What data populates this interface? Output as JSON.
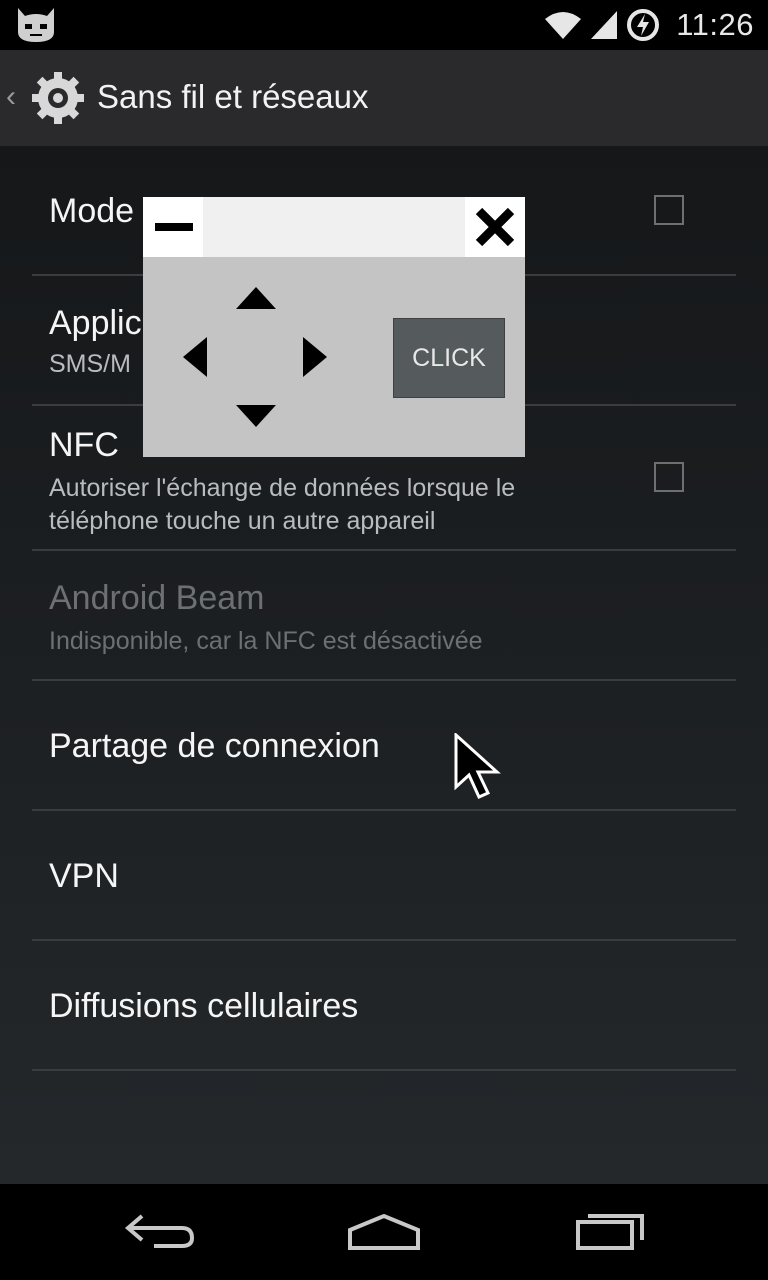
{
  "status_bar": {
    "time": "11:26",
    "icons": [
      "cyanogenmod-logo-icon",
      "wifi-icon",
      "signal-icon",
      "battery-charging-icon"
    ]
  },
  "action_bar": {
    "title": "Sans fil et réseaux",
    "icons": [
      "chevron-left-icon",
      "settings-gear-icon"
    ]
  },
  "settings": {
    "items": [
      {
        "title": "Mode ",
        "summary": "",
        "has_checkbox": true,
        "checked": false,
        "enabled": true
      },
      {
        "title": "Applic",
        "summary": "SMS/M",
        "has_checkbox": false,
        "enabled": true
      },
      {
        "title": "NFC",
        "summary": "Autoriser l'échange de données lorsque le téléphone touche un autre appareil",
        "has_checkbox": true,
        "checked": false,
        "enabled": true
      },
      {
        "title": "Android Beam",
        "summary": "Indisponible, car la NFC est désactivée",
        "has_checkbox": false,
        "enabled": false
      },
      {
        "title": "Partage de connexion",
        "summary": "",
        "has_checkbox": false,
        "enabled": true
      },
      {
        "title": "VPN",
        "summary": "",
        "has_checkbox": false,
        "enabled": true
      },
      {
        "title": "Diffusions cellulaires",
        "summary": "",
        "has_checkbox": false,
        "enabled": true
      }
    ]
  },
  "control_overlay": {
    "click_label": "CLICK",
    "icons": [
      "minimize-icon",
      "close-icon",
      "arrow-up-icon",
      "arrow-left-icon",
      "arrow-right-icon",
      "arrow-down-icon"
    ]
  },
  "nav_bar": {
    "icons": [
      "back-icon",
      "home-icon",
      "recent-apps-icon"
    ]
  },
  "colors": {
    "background_top": "#151719",
    "background_bottom": "#24282b",
    "divider": "#3a3d40",
    "disabled_text": "#6d7073",
    "overlay_bg": "#c4c4c4",
    "click_button": "#555a5d"
  }
}
